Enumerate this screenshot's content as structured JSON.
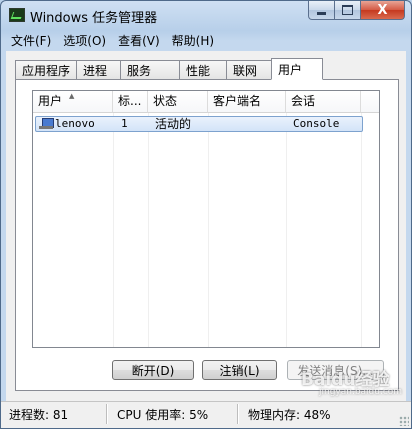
{
  "window": {
    "title": "Windows 任务管理器",
    "icon": "task-manager-icon"
  },
  "caption": {
    "close_glyph": "X"
  },
  "menu": [
    {
      "label": "文件(F)"
    },
    {
      "label": "选项(O)"
    },
    {
      "label": "查看(V)"
    },
    {
      "label": "帮助(H)"
    }
  ],
  "tabs": [
    {
      "label": "应用程序",
      "active": false
    },
    {
      "label": "进程",
      "active": false
    },
    {
      "label": "服务",
      "active": false
    },
    {
      "label": "性能",
      "active": false
    },
    {
      "label": "联网",
      "active": false
    },
    {
      "label": "用户",
      "active": true
    }
  ],
  "users_table": {
    "columns": [
      "用户",
      "标...",
      "状态",
      "客户端名",
      "会话"
    ],
    "sort_column": "用户",
    "sort_direction": "ascending",
    "rows": [
      {
        "user": "lenovo",
        "id": "1",
        "status": "活动的",
        "client_name": "",
        "session": "Console",
        "icon": "user-computer-icon",
        "selected": true
      }
    ]
  },
  "actions": {
    "disconnect_label": "断开(D)",
    "logoff_label": "注销(L)",
    "send_message_label": "发送消息(S)..."
  },
  "statusbar": {
    "processes": "进程数: 81",
    "cpu": "CPU 使用率: 5%",
    "memory": "物理内存: 48%"
  },
  "watermark": {
    "text": "Baidu经验",
    "sub": "jingyan.baidu.com"
  }
}
